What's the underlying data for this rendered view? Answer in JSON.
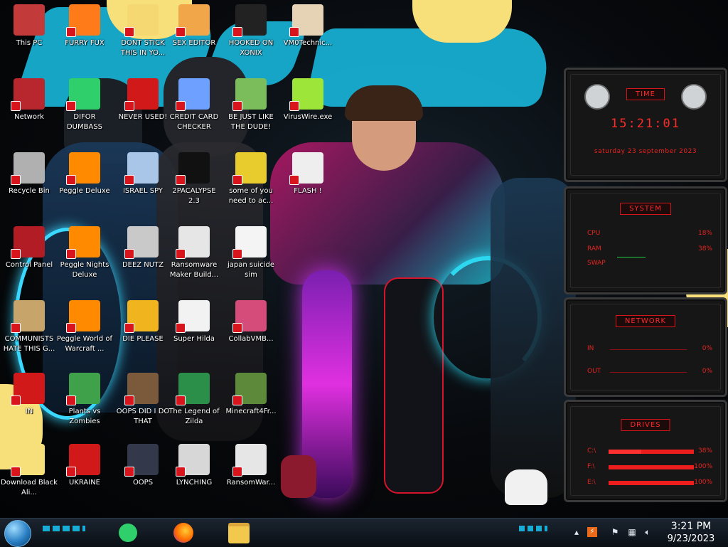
{
  "desktop": {
    "icons": [
      {
        "label": "This PC",
        "icon": "computer-icon"
      },
      {
        "label": "FURRY FUX",
        "icon": "firefox-icon"
      },
      {
        "label": "DONT STICK THIS IN YO...",
        "icon": "cartoon-face-icon"
      },
      {
        "label": "SEX EDITOR",
        "icon": "pixel-editor-icon"
      },
      {
        "label": "HOOKED ON XONIX",
        "icon": "xonix-game-icon"
      },
      {
        "label": "VM0Technic...",
        "icon": "doctor-icon"
      },
      {
        "label": "Network",
        "icon": "network-globe-icon"
      },
      {
        "label": "DIFOR DUMBASS",
        "icon": "chat-app-icon"
      },
      {
        "label": "NEVER USED!",
        "icon": "dev-icon"
      },
      {
        "label": "CREDIT CARD CHECKER",
        "icon": "credit-card-icon"
      },
      {
        "label": "BE JUST LIKE THE DUDE!",
        "icon": "santa-icon"
      },
      {
        "label": "VirusWire.exe",
        "icon": "lime-icon"
      },
      {
        "label": "Recycle Bin",
        "icon": "recycle-bin-icon"
      },
      {
        "label": "Peggle Deluxe",
        "icon": "peggle-icon"
      },
      {
        "label": "ISRAEL SPY",
        "icon": "spy-icon"
      },
      {
        "label": "2PACALYPSE 2.3",
        "icon": "terminal-icon"
      },
      {
        "label": "some of you need to ac...",
        "icon": "dog-icon"
      },
      {
        "label": "FLASH !",
        "icon": "flash-icon"
      },
      {
        "label": "Control Panel",
        "icon": "control-panel-icon"
      },
      {
        "label": "Peggle Nights Deluxe",
        "icon": "peggle-nights-icon"
      },
      {
        "label": "DEEZ NUTZ",
        "icon": "stacked-windows-icon"
      },
      {
        "label": "Ransomware Maker Build...",
        "icon": "ransomware-icon"
      },
      {
        "label": "japan suicide sim",
        "icon": "file-icon"
      },
      {
        "label": "COMMUNISTS HATE THIS G...",
        "icon": "money-bag-icon"
      },
      {
        "label": "Peggle World of Warcraft ...",
        "icon": "peggle-wow-icon"
      },
      {
        "label": "DIE PLEASE",
        "icon": "de-icon"
      },
      {
        "label": "Super Hilda",
        "icon": "pixel-cat-icon"
      },
      {
        "label": "CollabVMB...",
        "icon": "collabvm-icon"
      },
      {
        "label": "Download Black Ali...",
        "icon": "star-butterfly-icon"
      },
      {
        "label": "Plants vs Zombies",
        "icon": "plant-icon"
      },
      {
        "label": "OOPS DID I DO THAT",
        "icon": "portrait-icon"
      },
      {
        "label": "The Legend of Zilda",
        "icon": "zelda-icon"
      },
      {
        "label": "Minecraft4Fr...",
        "icon": "minecraft-icon"
      },
      {
        "label": "UKRAINE",
        "icon": "radiation-icon"
      },
      {
        "label": "OOPS",
        "icon": "oops-window-icon"
      },
      {
        "label": "LYNCHING",
        "icon": "flag-icon"
      },
      {
        "label": "RansomWar...",
        "icon": "skull-icon"
      },
      {
        "label": "IN",
        "icon": "partial-icon"
      }
    ]
  },
  "widgets": {
    "time": {
      "title": "TIME",
      "clock": "15:21:01",
      "date": "saturday 23 september 2023"
    },
    "system": {
      "title": "SYSTEM",
      "rows": [
        {
          "label": "CPU",
          "value": "18%",
          "level": 0.18
        },
        {
          "label": "RAM",
          "value": "38%",
          "level": 0.38
        },
        {
          "label": "SWAP",
          "value": "",
          "level": 0.0
        }
      ]
    },
    "network": {
      "title": "NETWORK",
      "rows": [
        {
          "label": "IN",
          "value": "0%"
        },
        {
          "label": "OUT",
          "value": "0%"
        }
      ]
    },
    "drives": {
      "title": "DRIVES",
      "rows": [
        {
          "label": "C:\\",
          "value": "38%",
          "level": 0.38
        },
        {
          "label": "F:\\",
          "value": "100%",
          "level": 1.0
        },
        {
          "label": "E:\\",
          "value": "100%",
          "level": 1.0
        }
      ]
    }
  },
  "taskbar": {
    "start_icon": "start-orb-icon",
    "pinned": [
      {
        "name": "chat-app-icon"
      },
      {
        "name": "firefox-icon"
      },
      {
        "name": "file-explorer-icon"
      }
    ],
    "time": "3:21 PM",
    "date": "9/23/2023"
  },
  "colors": {
    "accent": "#1ab4d6",
    "widget_red": "#e8231f",
    "taskbar": "#0f161d"
  }
}
